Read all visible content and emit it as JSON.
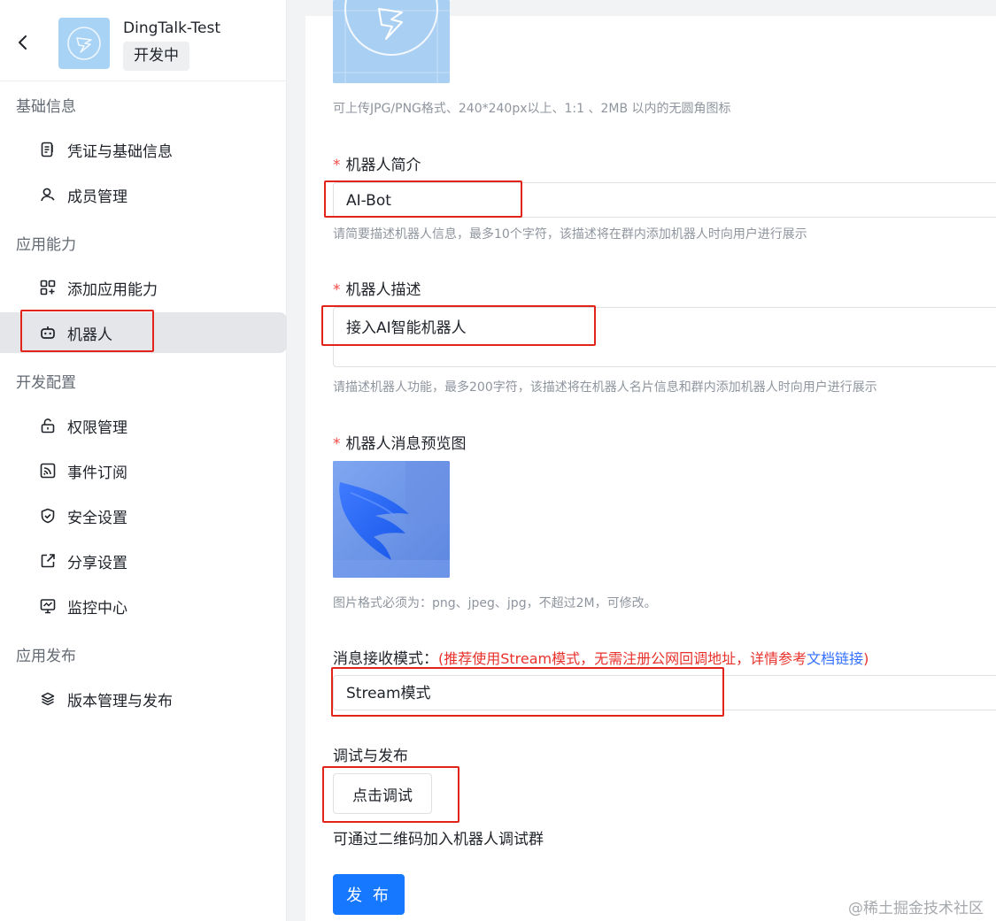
{
  "app": {
    "name": "DingTalk-Test",
    "status": "开发中"
  },
  "sidebar": {
    "groups": [
      {
        "title": "基础信息",
        "items": [
          {
            "label": "凭证与基础信息",
            "icon": "credential-icon"
          },
          {
            "label": "成员管理",
            "icon": "member-icon"
          }
        ]
      },
      {
        "title": "应用能力",
        "items": [
          {
            "label": "添加应用能力",
            "icon": "add-capability-icon"
          },
          {
            "label": "机器人",
            "icon": "robot-icon",
            "active": true
          }
        ]
      },
      {
        "title": "开发配置",
        "items": [
          {
            "label": "权限管理",
            "icon": "lock-icon"
          },
          {
            "label": "事件订阅",
            "icon": "rss-icon"
          },
          {
            "label": "安全设置",
            "icon": "shield-icon"
          },
          {
            "label": "分享设置",
            "icon": "share-icon"
          },
          {
            "label": "监控中心",
            "icon": "monitor-icon"
          }
        ]
      },
      {
        "title": "应用发布",
        "items": [
          {
            "label": "版本管理与发布",
            "icon": "layers-icon"
          }
        ]
      }
    ]
  },
  "form": {
    "icon_hint": "可上传JPG/PNG格式、240*240px以上、1:1 、2MB 以内的无圆角图标",
    "intro": {
      "label": "机器人简介",
      "value": "AI-Bot",
      "hint": "请简要描述机器人信息，最多10个字符，该描述将在群内添加机器人时向用户进行展示"
    },
    "description": {
      "label": "机器人描述",
      "value": "接入AI智能机器人",
      "hint": "请描述机器人功能，最多200字符，该描述将在机器人名片信息和群内添加机器人时向用户进行展示"
    },
    "preview": {
      "label": "机器人消息预览图",
      "hint": "图片格式必须为：png、jpeg、jpg，不超过2M，可修改。"
    },
    "mode": {
      "label": "消息接收模式：",
      "tip": "(推荐使用Stream模式，无需注册公网回调地址，详情参考",
      "link": "文档链接",
      "tip_end": ")",
      "value": "Stream模式"
    },
    "debug": {
      "label": "调试与发布",
      "button": "点击调试",
      "desc": "可通过二维码加入机器人调试群"
    },
    "publish_button": "发 布"
  },
  "watermark": "@稀土掘金技术社区",
  "colors": {
    "required": "#f54a45",
    "tip_red": "#e8312b",
    "link": "#3370ff",
    "primary": "#1677ff",
    "highlight_box": "#e2231a"
  }
}
